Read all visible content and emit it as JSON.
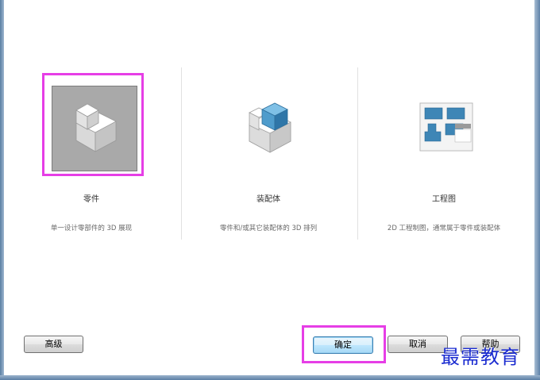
{
  "options": [
    {
      "label": "零件",
      "description": "单一设计零部件的 3D 展现",
      "icon": "part-block-icon",
      "selected": true
    },
    {
      "label": "装配体",
      "description": "零件和/或其它装配体的 3D 排列",
      "icon": "assembly-icon",
      "selected": false
    },
    {
      "label": "工程图",
      "description": "2D 工程制图，通常属于零件或装配体",
      "icon": "drawing-icon",
      "selected": false
    }
  ],
  "buttons": {
    "advanced": "高级",
    "ok": "确定",
    "cancel": "取消",
    "help": "帮助"
  },
  "watermark": "最需教育",
  "colors": {
    "highlight": "#e63ee6",
    "assembly_blue": "#3e86b6",
    "watermark": "#1a2bd0"
  }
}
